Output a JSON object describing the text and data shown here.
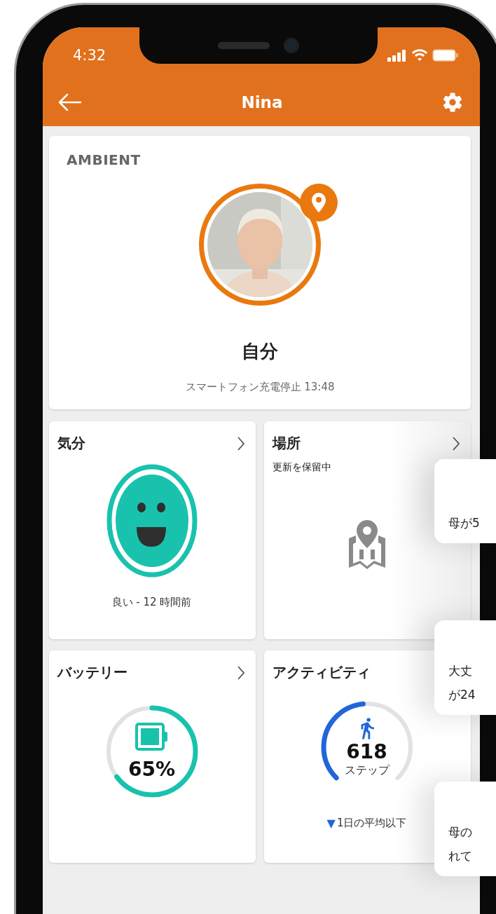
{
  "status_bar": {
    "time": "4:32"
  },
  "header": {
    "title": "Nina"
  },
  "profile": {
    "label": "AMBIENT",
    "name": "自分",
    "status": "スマートフォン充電停止 13:48",
    "location_badge": true
  },
  "tiles": [
    {
      "kind": "mood",
      "title": "気分",
      "caption": "良い - 12 時間前"
    },
    {
      "kind": "location",
      "title": "場所",
      "subtitle": "更新を保留中"
    },
    {
      "kind": "battery",
      "title": "バッテリー",
      "level": 0.65,
      "reading": "65%"
    },
    {
      "kind": "activity",
      "title": "アクティビティ",
      "level": 0.48,
      "count": "618",
      "unit": "ステップ",
      "trend": "▼",
      "caption": "1日の平均以下"
    }
  ],
  "notifications": [
    {
      "lines": [
        "母が5"
      ]
    },
    {
      "lines": [
        "大丈",
        "が24"
      ]
    },
    {
      "lines": [
        "母の",
        "れて"
      ]
    }
  ]
}
